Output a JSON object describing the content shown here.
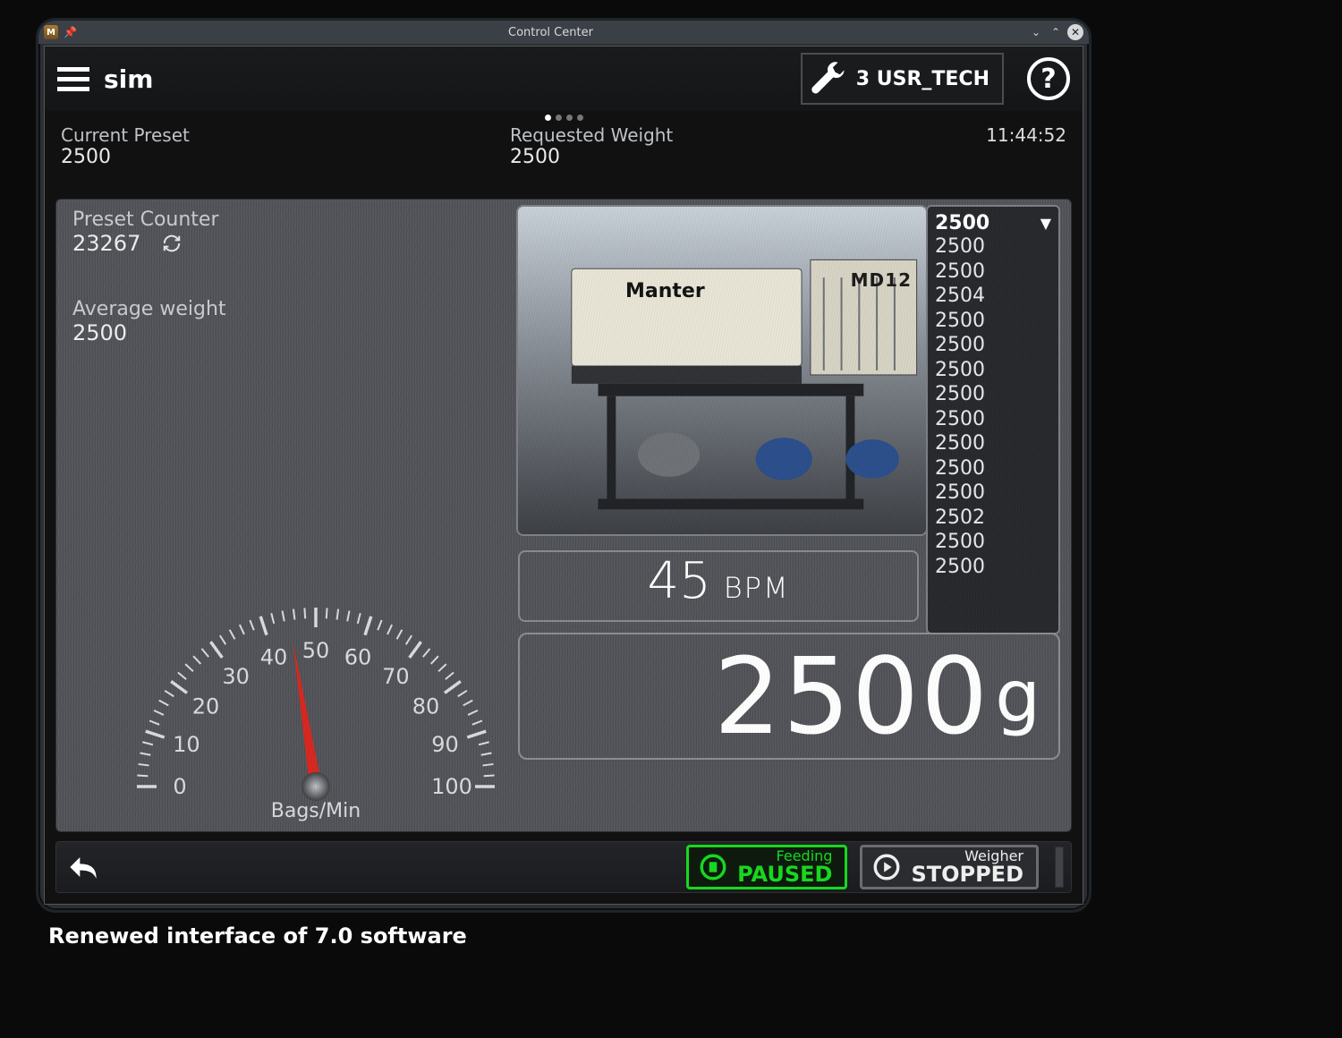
{
  "window": {
    "title": "Control Center"
  },
  "topbar": {
    "name": "sim",
    "user": "3 USR_TECH"
  },
  "info": {
    "preset_label": "Current Preset",
    "preset_value": "2500",
    "reqw_label": "Requested Weight",
    "reqw_value": "2500",
    "time": "11:44:52"
  },
  "stats": {
    "counter_label": "Preset Counter",
    "counter_value": "23267",
    "avg_label": "Average weight",
    "avg_value": "2500"
  },
  "gauge": {
    "caption": "Bags/Min",
    "ticks": [
      "0",
      "10",
      "20",
      "30",
      "40",
      "50",
      "60",
      "70",
      "80",
      "90",
      "100"
    ]
  },
  "machine": {
    "brand": "Manter",
    "model": "MD12"
  },
  "weight_list": [
    "2500",
    "2500",
    "2500",
    "2504",
    "2500",
    "2500",
    "2500",
    "2500",
    "2500",
    "2500",
    "2500",
    "2500",
    "2502",
    "2500",
    "2500"
  ],
  "bpm": {
    "value": "45",
    "unit": "BPM"
  },
  "bigweight": {
    "value": "2500",
    "unit": "g"
  },
  "footer": {
    "feeding_label": "Feeding",
    "feeding_state": "PAUSED",
    "weigher_label": "Weigher",
    "weigher_state": "STOPPED"
  },
  "caption": "Renewed interface of 7.0 software"
}
